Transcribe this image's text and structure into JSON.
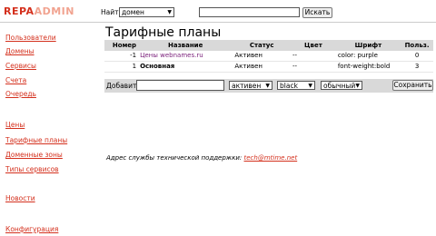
{
  "logo": {
    "part1": "REPA",
    "part2": "ADMIN"
  },
  "search": {
    "label": "Найти",
    "field_selected": "домен",
    "query_value": "",
    "button_label": "Искать"
  },
  "sidebar": {
    "items": [
      {
        "label": "Пользователи"
      },
      {
        "label": "Домены"
      },
      {
        "label": "Сервисы"
      },
      {
        "label": "Счета"
      },
      {
        "label": "Очередь"
      },
      {
        "label": "Цены"
      },
      {
        "label": "Тарифные планы"
      },
      {
        "label": "Доменные зоны"
      },
      {
        "label": "Типы сервисов"
      },
      {
        "label": "Новости"
      },
      {
        "label": "Конфигурация"
      }
    ]
  },
  "page": {
    "title": "Тарифные планы"
  },
  "table": {
    "headers": {
      "number": "Номер",
      "name": "Название",
      "status": "Статус",
      "color": "Цвет",
      "font": "Шрифт",
      "users": "Польз."
    },
    "rows": [
      {
        "number": "-1",
        "name": "Цены webnames.ru",
        "status": "Активен",
        "color": "--",
        "font": "color: purple",
        "users": "0"
      },
      {
        "number": "1",
        "name": "Основная",
        "status": "Активен",
        "color": "--",
        "font": "font-weight:bold",
        "users": "3"
      }
    ]
  },
  "add_form": {
    "label": "Добавить",
    "name_value": "",
    "status_selected": "активен",
    "color_selected": "black",
    "font_selected": "обычный",
    "save_label": "Сохранить"
  },
  "support": {
    "text": "Адрес службы технической поддержки:",
    "email": "tech@mtime.net"
  },
  "colors": {
    "accent": "#d4301d",
    "logo_light": "#f1a390",
    "header_bg": "#d9d9d9",
    "link_purple": "#7a1f7a"
  }
}
